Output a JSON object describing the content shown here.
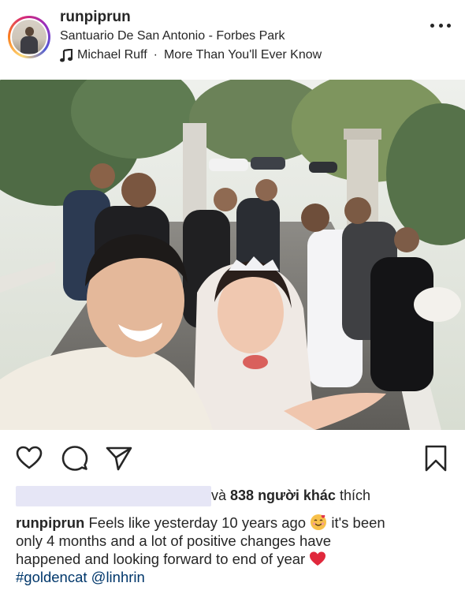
{
  "post": {
    "username": "runpiprun",
    "location": "Santuario De San Antonio - Forbes Park",
    "music_artist": "Michael Ruff",
    "music_separator": "·",
    "music_title": "More Than You'll Ever Know"
  },
  "likes": {
    "prefix": "và",
    "count_text": "838 người khác",
    "suffix": "thích"
  },
  "caption": {
    "username": "runpiprun",
    "line1": "Feels like yesterday 10 years ago",
    "line1_after": "it's been",
    "line2": "only 4 months and a lot of positive changes have",
    "line3": "happened and looking forward to end of year",
    "hashtag": "#goldencat",
    "mention": "@linhrin"
  },
  "icons": {
    "more": "more-dots-icon",
    "music": "music-note-icon",
    "like": "heart-outline-icon",
    "comment": "comment-bubble-icon",
    "share": "paper-plane-icon",
    "save": "bookmark-icon",
    "mute": "speaker-muted-icon"
  },
  "colors": {
    "text": "#262626",
    "link": "#00376b",
    "redacted": "#e6e6f6"
  }
}
